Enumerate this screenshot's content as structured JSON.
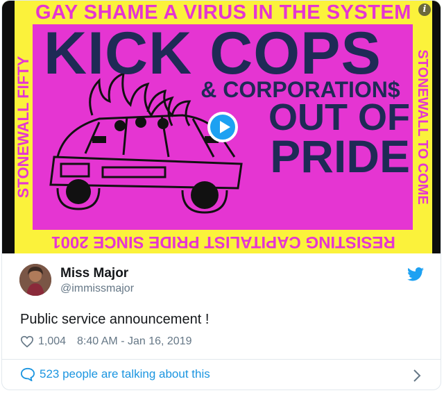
{
  "media": {
    "poster": {
      "top_text": "GAY SHAME A VIRUS IN THE SYSTEM",
      "bottom_text": "RESISTING CAPITALIST PRIDE SINCE 2001",
      "left_text": "STONEWALL FIFTY",
      "right_text": "STONEWALL TO COME",
      "headline": "KICK COPS",
      "subhead": "& CORPORATION$",
      "line3": "OUT OF",
      "line4": "PRIDE"
    },
    "play_icon": "play-button-icon",
    "info_icon": "info-icon",
    "info_label": "i"
  },
  "tweet": {
    "author_name": "Miss Major",
    "author_handle": "@immissmajor",
    "text": "Public service announcement !",
    "likes": "1,004",
    "timestamp": "8:40 AM - Jan 16, 2019",
    "talking_label": "523 people are talking about this"
  },
  "colors": {
    "poster_yellow": "#fbf23b",
    "poster_pink": "#e535d2",
    "poster_navy": "#1f2a56",
    "twitter_blue": "#1da1f2",
    "link_blue": "#1b95e0"
  }
}
